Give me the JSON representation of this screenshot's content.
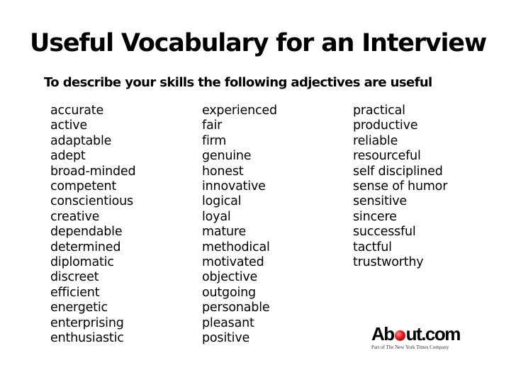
{
  "title": "Useful Vocabulary for an Interview",
  "subtitle": "To describe your skills the following adjectives are useful",
  "columns": [
    [
      "accurate",
      "active",
      "adaptable",
      "adept",
      "broad-minded",
      "competent",
      "conscientious",
      "creative",
      "dependable",
      "determined",
      "diplomatic",
      "discreet",
      "efficient",
      "energetic",
      "enterprising",
      "enthusiastic"
    ],
    [
      "experienced",
      "fair",
      "firm",
      "genuine",
      "honest",
      "innovative",
      "logical",
      "loyal",
      "mature",
      "methodical",
      "motivated",
      "objective",
      "outgoing",
      "personable",
      "pleasant",
      "positive"
    ],
    [
      "practical",
      "productive",
      "reliable",
      "resourceful",
      "self disciplined",
      "sense of humor",
      "sensitive",
      "sincere",
      "successful",
      "tactful",
      "trustworthy"
    ]
  ],
  "logo": {
    "part1": "Ab",
    "part2": "ut.com",
    "tm": ".",
    "tagline": "Part of The New York Times Company",
    "dot_color": "#e0181b"
  }
}
